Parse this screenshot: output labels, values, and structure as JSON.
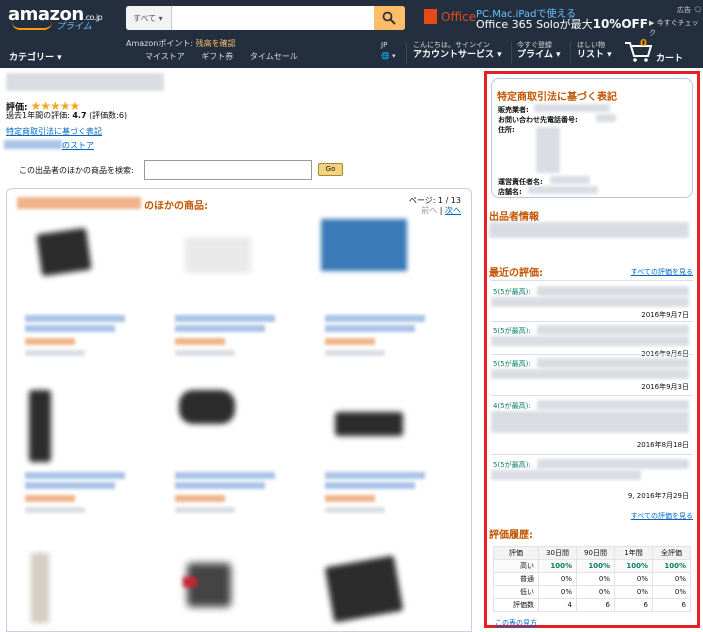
{
  "header": {
    "logo_text": "amazon",
    "logo_suffix": ".co.jp",
    "logo_sub": "プライム",
    "search": {
      "category": "すべて ▾",
      "placeholder": ""
    },
    "promo": {
      "brand": "Office",
      "line1": "PC.Mac.iPadで使える",
      "line2_prefix": "Office 365 Soloが最大",
      "line2_highlight": "10%OFF",
      "cta": "▶ 今すぐチェック",
      "ad_label": "広告 🗨"
    },
    "category_label": "カテゴリー ▾",
    "points_prefix": "Amazonポイント:",
    "points_value": "残高を確認",
    "nav_links": [
      "マイストア",
      "ギフト券",
      "タイムセール"
    ],
    "lang": {
      "top": "JP",
      "bottom": "🌐 ▾"
    },
    "account": {
      "top": "こんにちは。サインイン",
      "bottom": "アカウントサービス ▾"
    },
    "prime": {
      "top": "今すぐ登録",
      "bottom": "プライム ▾"
    },
    "lists": {
      "top": "ほしい物",
      "bottom": "リスト ▾"
    },
    "cart_count": "0",
    "cart_label": "カート"
  },
  "seller": {
    "rating_label": "評価:",
    "stars": "★★★★★",
    "rating_summary_prefix": "過去1年間の評価:",
    "rating_value": "4.7",
    "rating_count": "(評価数:6)",
    "legal_link": "特定商取引法に基づく表記",
    "store_link_suffix": "のストア",
    "search_label": "この出品者のほかの商品を検索:",
    "go_button": "Go"
  },
  "products": {
    "title_suffix": "のほかの商品:",
    "page_label": "ページ: 1 / 13",
    "prev": "前へ",
    "next": "次へ"
  },
  "right_panel": {
    "legal_title": "特定商取引法に基づく表記",
    "legal_rows": [
      "販売業者:",
      "お問い合わせ先電話番号:",
      "住所:",
      "運営責任者名:",
      "店舗名:"
    ],
    "seller_info_title": "出品者情報",
    "recent_reviews_title": "最近の評価:",
    "all_reviews_link": "すべての評価を見る",
    "reviews": [
      {
        "stars": "5(5が最高):",
        "date": "2016年9月7日"
      },
      {
        "stars": "5(5が最高):",
        "date": "2016年9月6日"
      },
      {
        "stars": "5(5が最高):",
        "date": "2016年9月3日"
      },
      {
        "stars": "4(5が最高):",
        "date": "2016年8月18日"
      },
      {
        "stars": "5(5が最高):",
        "date": "9, 2016年7月29日"
      }
    ],
    "history_title": "評価履歴:",
    "history_table": {
      "headers": [
        "評価",
        "30日間",
        "90日間",
        "1年間",
        "全評価"
      ],
      "rows": [
        {
          "label": "高い",
          "values": [
            "100%",
            "100%",
            "100%",
            "100%"
          ]
        },
        {
          "label": "普通",
          "values": [
            "0%",
            "0%",
            "0%",
            "0%"
          ]
        },
        {
          "label": "低い",
          "values": [
            "0%",
            "0%",
            "0%",
            "0%"
          ]
        },
        {
          "label": "評価数",
          "values": [
            "4",
            "6",
            "6",
            "6"
          ]
        }
      ]
    },
    "table_link": "この表の見方"
  }
}
